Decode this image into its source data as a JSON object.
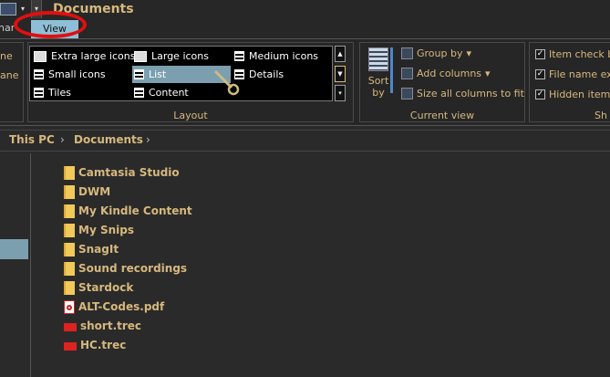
{
  "window": {
    "title": "Documents"
  },
  "tabs": {
    "previous_fragment": "nar",
    "active": "View"
  },
  "ribbon": {
    "left_fragments": [
      "ne",
      "ane"
    ],
    "layout": {
      "label": "Layout",
      "items": [
        {
          "label": "Extra large icons"
        },
        {
          "label": "Large icons"
        },
        {
          "label": "Medium icons"
        },
        {
          "label": "Small icons"
        },
        {
          "label": "List",
          "selected": true
        },
        {
          "label": "Details"
        },
        {
          "label": "Tiles"
        },
        {
          "label": "Content"
        }
      ]
    },
    "current_view": {
      "label": "Current view",
      "sort_by": "Sort by",
      "group_by": "Group by",
      "add_columns": "Add columns",
      "size_all": "Size all columns to fit"
    },
    "show_hide": {
      "label_fragment": "Sh",
      "item_check_boxes": "Item check b",
      "file_name_extensions": "File name ex",
      "hidden_items": "Hidden item",
      "checked": [
        true,
        true,
        true
      ]
    }
  },
  "address": {
    "crumbs": [
      "This PC",
      "Documents"
    ]
  },
  "files": [
    {
      "name": "Camtasia Studio",
      "type": "folder"
    },
    {
      "name": "DWM",
      "type": "folder"
    },
    {
      "name": "My Kindle Content",
      "type": "folder"
    },
    {
      "name": "My Snips",
      "type": "folder"
    },
    {
      "name": "SnagIt",
      "type": "folder"
    },
    {
      "name": "Sound recordings",
      "type": "folder"
    },
    {
      "name": "Stardock",
      "type": "folder"
    },
    {
      "name": "ALT-Codes.pdf",
      "type": "pdf"
    },
    {
      "name": "short.trec",
      "type": "trec"
    },
    {
      "name": "HC.trec",
      "type": "trec"
    }
  ],
  "colors": {
    "accent_text": "#d6b87e",
    "selection": "#7b9fae",
    "highlight_ring": "#e01010",
    "active_tab": "#8fbfd6"
  }
}
